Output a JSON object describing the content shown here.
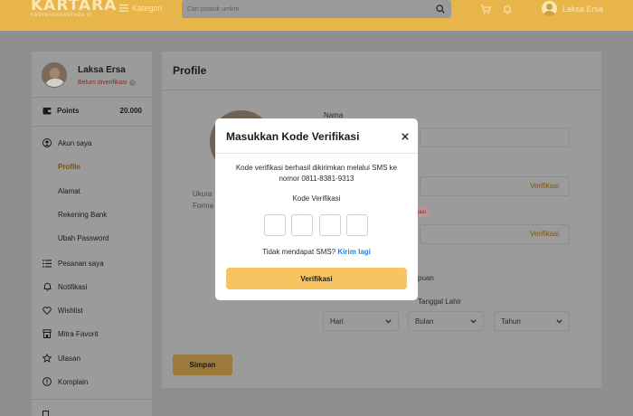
{
  "header": {
    "logo": "KARTARA",
    "logo_sub": "KARYANGKSARTARA.ID",
    "kategori_label": "Kategori",
    "search_placeholder": "Cari produk umkm",
    "user_name": "Laksa Ersa",
    "icons": [
      "menu-icon",
      "search-icon",
      "cart-icon",
      "bell-icon",
      "user-avatar"
    ]
  },
  "sidebar": {
    "name": "Laksa Ersa",
    "status": "Belum diverifikasi",
    "points_label": "Points",
    "points_value": "20.000",
    "nav": {
      "akun": "Akun saya",
      "profile": "Profile",
      "alamat": "Alamat",
      "rekening": "Rekening Bank",
      "password": "Ubah Password",
      "pesanan": "Pesanan saya",
      "notifikasi": "Notifikasi",
      "wishlist": "Wishlist",
      "mitra": "Mitra Favorit",
      "ulasan": "Ulasan",
      "komplain": "Komplain"
    }
  },
  "main": {
    "title": "Profile",
    "photo_note_line1": "Ukura",
    "photo_note_line2": "Forma",
    "nama_label": "Nama",
    "link1": "Verifikasi",
    "badge": "ifikasi",
    "link2": "Verifikasi",
    "gender_partial": "puan",
    "tanggal_label": "Tanggal Lahir",
    "hari": "Hari",
    "bulan": "Bulan",
    "tahun": "Tahun",
    "simpan": "Simpan"
  },
  "modal": {
    "title": "Masukkan Kode Verifikasi",
    "message": "Kode verifikasi berhasil dikirimkan melalui SMS ke nomor 0811-8381-9313",
    "code_label": "Kode Verifikasi",
    "resend_text": "Tidak mendapat SMS?",
    "resend_link": "Kirim lagi",
    "button": "Verifikasi"
  },
  "colors": {
    "brand": "#f6c460",
    "link": "#2a83d6",
    "header_dimmed": "#e8b54a",
    "overlay": "#8f8f8f"
  }
}
